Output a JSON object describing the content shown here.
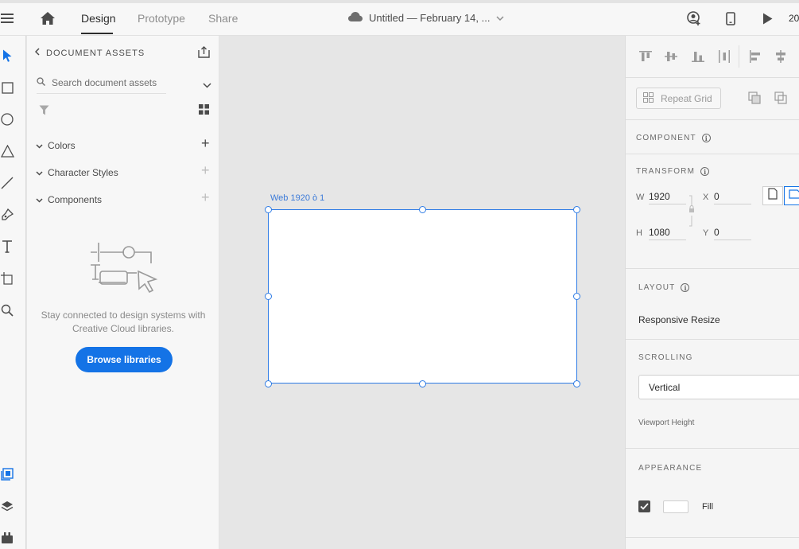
{
  "topbar": {
    "tabs": [
      {
        "label": "Design",
        "active": true
      },
      {
        "label": "Prototype",
        "active": false
      },
      {
        "label": "Share",
        "active": false
      }
    ],
    "document_title": "Untitled — February 14, ...",
    "zoom": "20"
  },
  "assets": {
    "header": "DOCUMENT ASSETS",
    "search_placeholder": "Search document assets",
    "sections": [
      {
        "label": "Colors"
      },
      {
        "label": "Character Styles"
      },
      {
        "label": "Components"
      }
    ],
    "empty_message": "Stay connected to design systems with Creative Cloud libraries.",
    "browse_button": "Browse libraries"
  },
  "canvas": {
    "artboard_label": "Web 1920 ò 1"
  },
  "inspector": {
    "repeat_grid": "Repeat Grid",
    "component_title": "COMPONENT",
    "transform_title": "TRANSFORM",
    "transform": {
      "w_label": "W",
      "w_value": "1920",
      "h_label": "H",
      "h_value": "1080",
      "x_label": "X",
      "x_value": "0",
      "y_label": "Y",
      "y_value": "0"
    },
    "layout_title": "LAYOUT",
    "responsive_resize": "Responsive Resize",
    "scrolling_title": "SCROLLING",
    "scrolling_value": "Vertical",
    "viewport_height": "Viewport Height",
    "appearance_title": "APPEARANCE",
    "fill_label": "Fill",
    "fill_checked": true,
    "fill_color": "#ffffff"
  },
  "colors": {
    "accent": "#1473e6",
    "selection": "#2d7be5"
  }
}
